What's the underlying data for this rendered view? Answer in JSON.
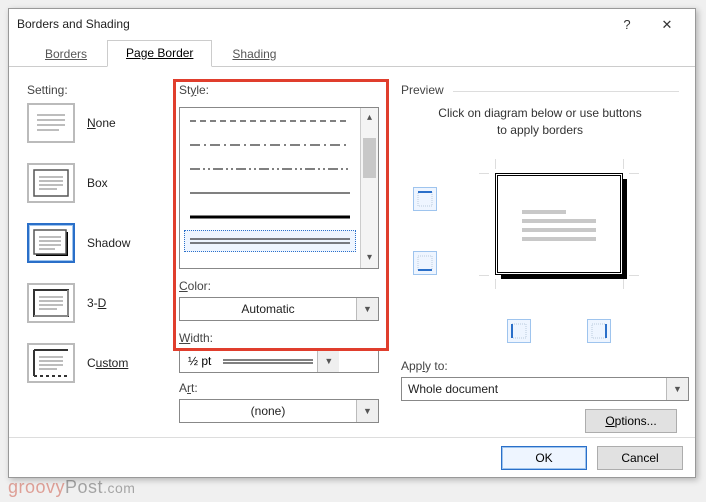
{
  "window": {
    "title": "Borders and Shading",
    "help": "?",
    "close": "✕"
  },
  "tabs": {
    "borders": "Borders",
    "page_border": "Page Border",
    "shading": "Shading",
    "active": "page_border"
  },
  "setting": {
    "heading": "Setting:",
    "items": [
      {
        "label_pre": "N",
        "label_post": "one",
        "selected": false,
        "kind": "none"
      },
      {
        "label_pre": "",
        "label_post": "Box",
        "selected": false,
        "kind": "box"
      },
      {
        "label_pre": "",
        "label_post": "Shadow",
        "selected": true,
        "kind": "shadow"
      },
      {
        "label_pre": "3-",
        "label_post": "D",
        "selected": false,
        "kind": "3d"
      },
      {
        "label_pre": "C",
        "label_post": "ustom",
        "selected": false,
        "kind": "custom"
      }
    ]
  },
  "style": {
    "heading_pre": "St",
    "heading_ul": "y",
    "heading_post": "le:",
    "color_pre": "",
    "color_ul": "C",
    "color_post": "olor:",
    "color_value": "Automatic",
    "width_pre": "",
    "width_ul": "W",
    "width_post": "idth:",
    "width_value": "½ pt",
    "art_pre": "A",
    "art_ul": "r",
    "art_post": "t:",
    "art_value": "(none)"
  },
  "preview": {
    "heading": "Preview",
    "instruction_l1": "Click on diagram below or use buttons",
    "instruction_l2": "to apply borders",
    "apply_pre": "App",
    "apply_ul": "l",
    "apply_post": "y to:",
    "apply_value": "Whole document",
    "options": "Options..."
  },
  "footer": {
    "ok": "OK",
    "cancel": "Cancel"
  },
  "watermark": {
    "pre": "groovy",
    "post": "Post",
    "suffix": ".com"
  }
}
